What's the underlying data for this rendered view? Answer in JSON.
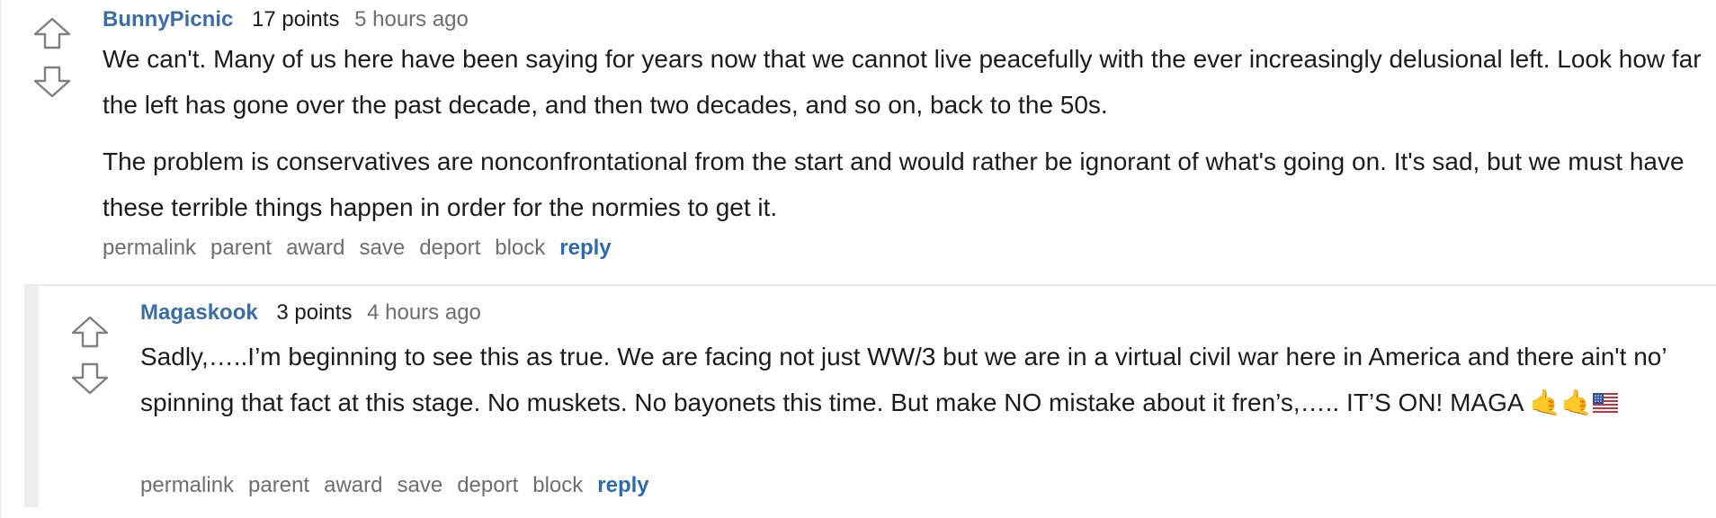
{
  "comments": [
    {
      "author": "BunnyPicnic",
      "points": "17 points",
      "time": "5 hours ago",
      "paragraphs": [
        "We can't. Many of us here have been saying for years now that we cannot live peacefully with the ever increasingly delusional left. Look how far the left has gone over the past decade, and then two decades, and so on, back to the 50s.",
        "The problem is conservatives are nonconfrontational from the start and would rather be ignorant of what's going on. It's sad, but we must have these terrible things happen in order for the normies to get it."
      ],
      "actions": {
        "permalink": "permalink",
        "parent": "parent",
        "award": "award",
        "save": "save",
        "deport": "deport",
        "block": "block",
        "reply": "reply"
      }
    },
    {
      "author": "Magaskook",
      "points": "3 points",
      "time": "4 hours ago",
      "paragraphs": [
        "Sadly,…..I’m beginning to see this as true. We are facing not just WW/3 but we are in a virtual civil war here in America and there ain't no’ spinning that fact at this stage. No muskets. No bayonets this time. But make NO mistake about it fren’s,….. IT’S ON! MAGA"
      ],
      "emoji": "🤙🤙",
      "actions": {
        "permalink": "permalink",
        "parent": "parent",
        "award": "award",
        "save": "save",
        "deport": "deport",
        "block": "block",
        "reply": "reply"
      }
    }
  ],
  "colors": {
    "author": "#3a6ea5",
    "reply": "#2d6ab0",
    "muted": "#6b6e72",
    "text": "#1c1c1c"
  },
  "icons": {
    "upvote": "arrow-up-outline-icon",
    "downvote": "arrow-down-outline-icon",
    "flag": "us-flag-icon"
  }
}
